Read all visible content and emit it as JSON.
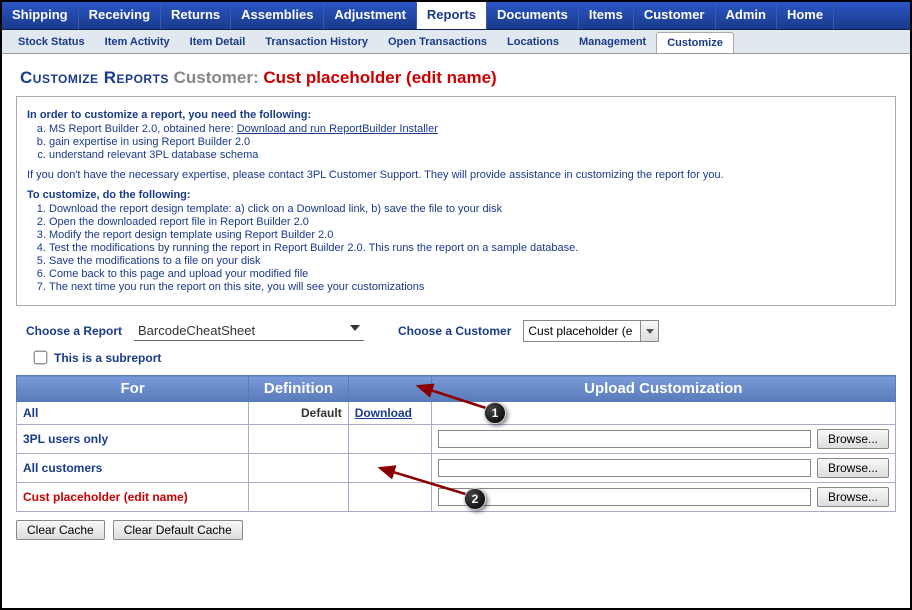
{
  "topnav": [
    "Shipping",
    "Receiving",
    "Returns",
    "Assemblies",
    "Adjustment",
    "Reports",
    "Documents",
    "Items",
    "Customer",
    "Admin",
    "Home"
  ],
  "topnav_active": 5,
  "subnav": [
    "Stock Status",
    "Item Activity",
    "Item Detail",
    "Transaction History",
    "Open Transactions",
    "Locations",
    "Management",
    "Customize"
  ],
  "subnav_active": 7,
  "title": {
    "part1": "Customize Reports",
    "part2": "Customer:",
    "part3": "Cust placeholder (edit name)"
  },
  "instructions": {
    "heading1": "In order to customize a report, you need the following:",
    "req": [
      "MS Report Builder 2.0, obtained here: ",
      "gain expertise in using Report Builder 2.0",
      "understand relevant 3PL database schema"
    ],
    "req_link": "Download and run ReportBuilder Installer",
    "para": "If you don't have the necessary expertise, please contact 3PL Customer Support. They will provide assistance in customizing the report for you.",
    "heading2": "To customize, do the following:",
    "steps": [
      "Download the report design template: a) click on a Download link, b) save the file to your disk",
      "Open the downloaded report file in Report Builder 2.0",
      "Modify the report design template using Report Builder 2.0",
      "Test the modifications by running the report in Report Builder 2.0. This runs the report on a sample database.",
      "Save the modifications to a file on your disk",
      "Come back to this page and upload your modified file",
      "The next time you run the report on this site, you will see your customizations"
    ]
  },
  "selectors": {
    "report_label": "Choose a Report",
    "report_value": "BarcodeCheatSheet",
    "customer_label": "Choose a Customer",
    "customer_value": "Cust placeholder (e"
  },
  "subreport": {
    "label": "This is a subreport",
    "checked": false
  },
  "table": {
    "headers": [
      "For",
      "Definition",
      "",
      "Upload Customization"
    ],
    "rows": [
      {
        "for": "All",
        "def": "Default",
        "dl": "Download",
        "upload": false,
        "red": false
      },
      {
        "for": "3PL users only",
        "def": "",
        "dl": "",
        "upload": true,
        "red": false
      },
      {
        "for": "All customers",
        "def": "",
        "dl": "",
        "upload": true,
        "red": false
      },
      {
        "for": "Cust placeholder (edit name)",
        "def": "",
        "dl": "",
        "upload": true,
        "red": true
      }
    ],
    "browse_label": "Browse..."
  },
  "buttons": {
    "clear_cache": "Clear Cache",
    "clear_default": "Clear Default Cache"
  },
  "annotations": {
    "badge1": "1",
    "badge2": "2"
  }
}
